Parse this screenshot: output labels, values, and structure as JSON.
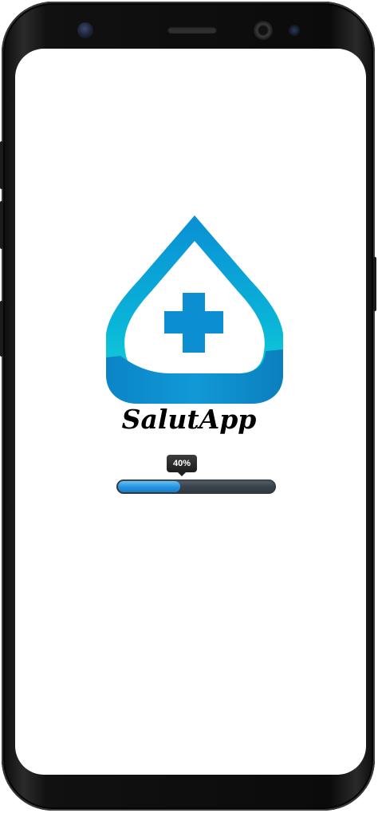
{
  "app": {
    "name": "SalutApp"
  },
  "progress": {
    "label": "40%",
    "value_percent": 40
  },
  "colors": {
    "logo_cyan": "#13d4d8",
    "logo_blue": "#0f8fd0",
    "progress_fill": "#2592df",
    "progress_track": "#3a434b",
    "tooltip_bg": "#2a2a2a"
  },
  "icons": {
    "logo": "medical-drop-cross-icon"
  }
}
